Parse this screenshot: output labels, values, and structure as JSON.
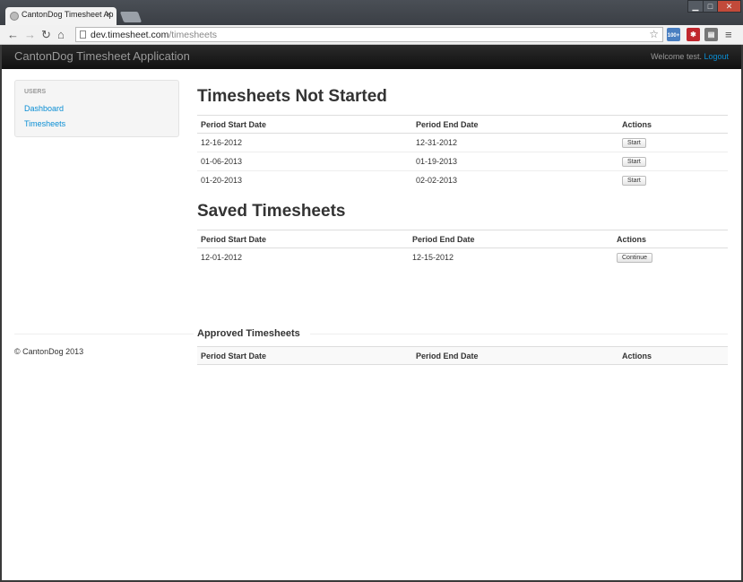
{
  "browser": {
    "tab_title": "CantonDog Timesheet Ap",
    "url_host": "dev.timesheet.com",
    "url_path": "/timesheets",
    "ext_badge": "100+"
  },
  "navbar": {
    "brand": "CantonDog Timesheet Application",
    "welcome": "Welcome test.",
    "logout": "Logout"
  },
  "sidebar": {
    "header": "USERS",
    "items": [
      {
        "label": "Dashboard"
      },
      {
        "label": "Timesheets"
      }
    ]
  },
  "not_started": {
    "title": "Timesheets Not Started",
    "headers": [
      "Period Start Date",
      "Period End Date",
      "Actions"
    ],
    "rows": [
      {
        "start": "12-16-2012",
        "end": "12-31-2012",
        "action": "Start"
      },
      {
        "start": "01-06-2013",
        "end": "01-19-2013",
        "action": "Start"
      },
      {
        "start": "01-20-2013",
        "end": "02-02-2013",
        "action": "Start"
      }
    ]
  },
  "saved": {
    "title": "Saved Timesheets",
    "headers": [
      "Period Start Date",
      "Period End Date",
      "Actions"
    ],
    "rows": [
      {
        "start": "12-01-2012",
        "end": "12-15-2012",
        "action": "Continue"
      }
    ]
  },
  "approved": {
    "title": "Approved Timesheets",
    "headers": [
      "Period Start Date",
      "Period End Date",
      "Actions"
    ]
  },
  "footer": {
    "text": "© CantonDog 2013"
  },
  "colors": {
    "link": "#0a8ed4",
    "navbar": "#1b1b1b"
  }
}
